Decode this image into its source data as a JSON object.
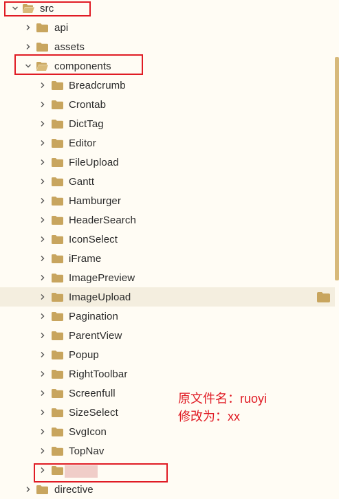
{
  "tree": {
    "src": {
      "label": "src",
      "expanded": true
    },
    "src_children": [
      {
        "label": "api",
        "expanded": false
      },
      {
        "label": "assets",
        "expanded": false
      }
    ],
    "components": {
      "label": "components",
      "expanded": true
    },
    "components_children": [
      {
        "label": "Breadcrumb"
      },
      {
        "label": "Crontab"
      },
      {
        "label": "DictTag"
      },
      {
        "label": "Editor"
      },
      {
        "label": "FileUpload"
      },
      {
        "label": "Gantt"
      },
      {
        "label": "Hamburger"
      },
      {
        "label": "HeaderSearch"
      },
      {
        "label": "IconSelect"
      },
      {
        "label": "iFrame"
      },
      {
        "label": "ImagePreview"
      },
      {
        "label": "ImageUpload",
        "selected": true
      },
      {
        "label": "Pagination"
      },
      {
        "label": "ParentView"
      },
      {
        "label": "Popup"
      },
      {
        "label": "RightToolbar"
      },
      {
        "label": "Screenfull"
      },
      {
        "label": "SizeSelect"
      },
      {
        "label": "SvgIcon"
      },
      {
        "label": "TopNav"
      },
      {
        "label": ""
      }
    ],
    "after_components": [
      {
        "label": "directive"
      }
    ]
  },
  "annotation": {
    "line1": "原文件名：ruoyi",
    "line2": "修改为：xx"
  },
  "colors": {
    "folder": "#c8a55e",
    "highlight_box": "#e01b24",
    "selected_row": "#f4eedf",
    "scrollbar": "#d7b97a"
  }
}
